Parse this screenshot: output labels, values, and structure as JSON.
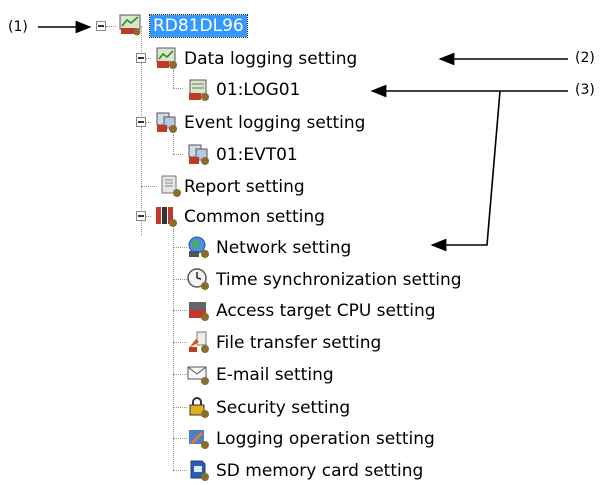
{
  "tree": {
    "root": {
      "label": "RD81DL96",
      "icon": "module-icon",
      "selected": true
    },
    "items": [
      {
        "label": "Data logging setting",
        "icon": "data-logging-icon"
      },
      {
        "label": "01:LOG01",
        "icon": "log-file-icon"
      },
      {
        "label": "Event logging setting",
        "icon": "event-logging-icon"
      },
      {
        "label": "01:EVT01",
        "icon": "event-file-icon"
      },
      {
        "label": "Report setting",
        "icon": "report-icon"
      },
      {
        "label": "Common setting",
        "icon": "common-setting-icon"
      },
      {
        "label": "Network setting",
        "icon": "network-globe-icon"
      },
      {
        "label": "Time synchronization setting",
        "icon": "clock-icon"
      },
      {
        "label": "Access target CPU setting",
        "icon": "cpu-module-icon"
      },
      {
        "label": "File transfer setting",
        "icon": "file-transfer-icon"
      },
      {
        "label": "E-mail setting",
        "icon": "envelope-icon"
      },
      {
        "label": "Security setting",
        "icon": "padlock-icon"
      },
      {
        "label": "Logging operation setting",
        "icon": "logging-operation-icon"
      },
      {
        "label": "SD memory card setting",
        "icon": "sd-card-icon"
      }
    ]
  },
  "callouts": {
    "c1": "(1)",
    "c2": "(2)",
    "c3": "(3)"
  },
  "colors": {
    "selection": "#3399ff",
    "tree_lines": "#999999",
    "arrows": "#000000"
  }
}
